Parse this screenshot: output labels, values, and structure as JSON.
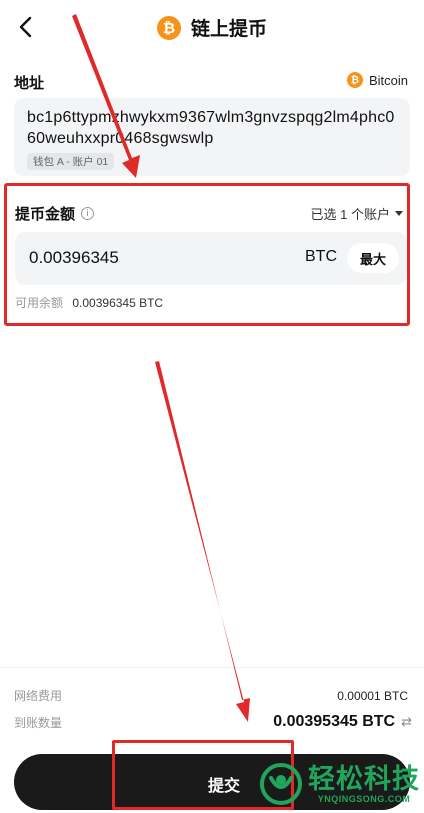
{
  "header": {
    "title": "链上提币",
    "coin_symbol": "₿",
    "back_icon": "chevron-left-icon"
  },
  "address": {
    "label": "地址",
    "network": "Bitcoin",
    "value": "bc1p6ttypmzhwykxm9367wlm3gnvzspqg2lm4phc060weuhxxpr0468sgwswlp",
    "wallet_tag": "钱包 A - 账户 01"
  },
  "amount": {
    "label": "提币金额",
    "account_select": "已选 1 个账户",
    "value": "0.00396345",
    "unit": "BTC",
    "max_label": "最大",
    "available_label": "可用余额",
    "available_value": "0.00396345 BTC"
  },
  "summary": {
    "fee_label": "网络费用",
    "fee_value": "0.00001 BTC",
    "receive_label": "到账数量",
    "receive_value": "0.00395345 BTC"
  },
  "submit": {
    "label": "提交"
  },
  "watermark": {
    "cn": "轻松科技",
    "en": "YNQINGSONG.COM"
  },
  "colors": {
    "accent_btc": "#f7931a",
    "annotation_red": "#e02a2a",
    "button_dark": "#1a1a1a",
    "watermark_green": "#1fa65a"
  }
}
